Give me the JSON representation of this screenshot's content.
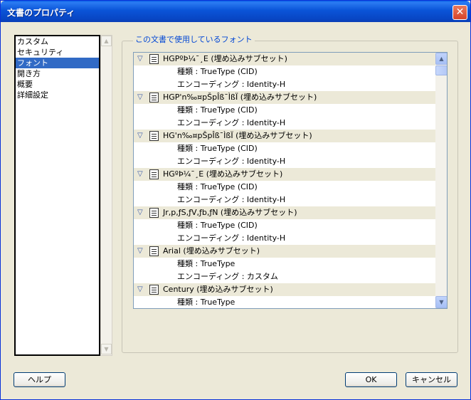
{
  "window": {
    "title": "文書のプロパティ",
    "close_label": "✕"
  },
  "sidebar": {
    "items": [
      {
        "label": "カスタム",
        "selected": false
      },
      {
        "label": "セキュリティ",
        "selected": false
      },
      {
        "label": "フォント",
        "selected": true
      },
      {
        "label": "開き方",
        "selected": false
      },
      {
        "label": "概要",
        "selected": false
      },
      {
        "label": "詳細設定",
        "selected": false
      }
    ]
  },
  "fonts_panel": {
    "legend": "この文書で使用しているフォント",
    "rows": [
      {
        "kind": "font",
        "text": "HGPºÞ¼¯¸E (埋め込みサブセット)"
      },
      {
        "kind": "detail",
        "text": "種類 : TrueType (CID)"
      },
      {
        "kind": "detail",
        "text": "エンコーディング : Identity-H"
      },
      {
        "kind": "font",
        "text": "HGP'n‰¤pŠpÎß¯ÌßÏ (埋め込みサブセット)"
      },
      {
        "kind": "detail",
        "text": "種類 : TrueType (CID)"
      },
      {
        "kind": "detail",
        "text": "エンコーディング : Identity-H"
      },
      {
        "kind": "font",
        "text": "HG'n‰¤pŠpÎß¯ÌßÏ (埋め込みサブセット)"
      },
      {
        "kind": "detail",
        "text": "種類 : TrueType (CID)"
      },
      {
        "kind": "detail",
        "text": "エンコーディング : Identity-H"
      },
      {
        "kind": "font",
        "text": "HGºÞ¼¯¸E (埋め込みサブセット)"
      },
      {
        "kind": "detail",
        "text": "種類 : TrueType (CID)"
      },
      {
        "kind": "detail",
        "text": "エンコーディング : Identity-H"
      },
      {
        "kind": "font",
        "text": "Jr,p,ƒS,ƒV,ƒb,ƒN (埋め込みサブセット)"
      },
      {
        "kind": "detail",
        "text": "種類 : TrueType (CID)"
      },
      {
        "kind": "detail",
        "text": "エンコーディング : Identity-H"
      },
      {
        "kind": "font",
        "text": "Arial (埋め込みサブセット)"
      },
      {
        "kind": "detail",
        "text": "種類 : TrueType"
      },
      {
        "kind": "detail",
        "text": "エンコーディング : カスタム"
      },
      {
        "kind": "font",
        "text": "Century (埋め込みサブセット)"
      },
      {
        "kind": "detail",
        "text": "種類 : TrueType"
      }
    ]
  },
  "buttons": {
    "help": "ヘルプ",
    "ok": "OK",
    "cancel": "キャンセル"
  },
  "icons": {
    "expand": "triangle-down-icon",
    "font": "document-font-icon"
  },
  "colors": {
    "title_bar": "#0a54d8",
    "selection": "#316ac5",
    "legend": "#0046d5",
    "close": "#d5432a"
  }
}
